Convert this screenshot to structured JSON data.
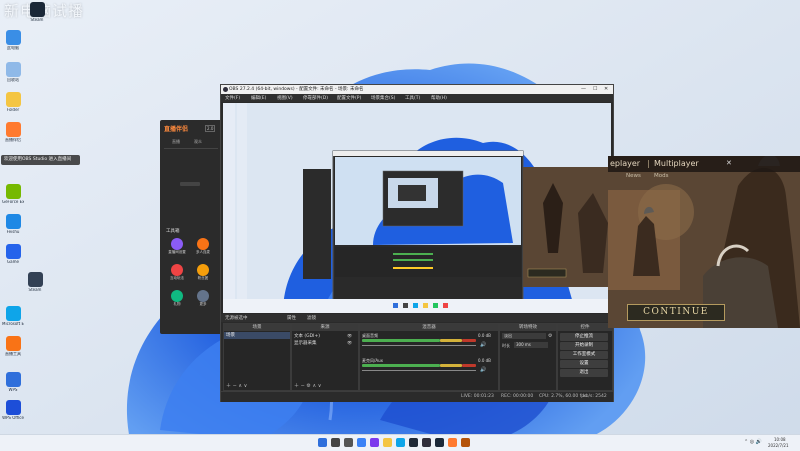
{
  "watermark": "新电脑试播",
  "desktop": {
    "icons": [
      {
        "label": "Steam",
        "icon": "steam-icon",
        "color": "#1b2838"
      },
      {
        "label": "此电脑",
        "icon": "computer-icon",
        "color": "#3a8ee6"
      },
      {
        "label": "回收站",
        "icon": "recycle-bin-icon",
        "color": "#8fb9e8"
      },
      {
        "label": "Folder",
        "icon": "folder-icon",
        "color": "#f4c542"
      },
      {
        "label": "直播伴侣",
        "icon": "live-companion-icon",
        "color": "#ff7a2f"
      },
      {
        "label": "GeForce Experience",
        "icon": "nvidia-icon",
        "color": "#76b900"
      },
      {
        "label": "Feishu",
        "icon": "feishu-icon",
        "color": "#1e88e5"
      },
      {
        "label": "Game",
        "icon": "game-icon",
        "color": "#2563eb"
      },
      {
        "label": "Steam",
        "icon": "steam-small-icon",
        "color": "#334155"
      },
      {
        "label": "Microsoft Edge",
        "icon": "edge-icon",
        "color": "#0ea5e9"
      },
      {
        "label": "直播工具",
        "icon": "live-tool-icon",
        "color": "#f97316"
      },
      {
        "label": "WPS",
        "icon": "wps-icon",
        "color": "#2f6fdb"
      },
      {
        "label": "WPS Office",
        "icon": "wps-office-icon",
        "color": "#1d4ed8"
      }
    ],
    "tooltip": "欢迎使用OBS Studio 进入直播间"
  },
  "recording_app": {
    "title": "直播伴侣",
    "version": "2.0",
    "tabs": [
      "直播",
      "观众"
    ],
    "toolbox_label": "工具箱",
    "tools": [
      "直播间设置",
      "多人连麦",
      "互动玩法",
      "粉丝团",
      "礼物",
      "更多"
    ]
  },
  "obs": {
    "title": "OBS 27.2.4 (64-bit, windows) - 配置文件: 未命名 - 场景: 未命名",
    "menu": [
      "文件(F)",
      "编辑(E)",
      "视图(V)",
      "停靠部件(D)",
      "配置文件(P)",
      "场景集合(S)",
      "工具(T)",
      "帮助(H)"
    ],
    "source_bar": {
      "label": "无源被选中",
      "props": "属性",
      "filters": "滤镜"
    },
    "docks": {
      "scenes": {
        "title": "场景",
        "items": [
          "场景"
        ]
      },
      "sources": {
        "title": "来源",
        "items": [
          "文本 (GDI+)",
          "显示器采集"
        ]
      },
      "mixer": {
        "title": "混音器",
        "channels": [
          {
            "name": "桌面音频",
            "db": "0.0 dB"
          },
          {
            "name": "麦克风/Aux",
            "db": "0.0 dB"
          }
        ]
      },
      "transitions": {
        "title": "转场特效",
        "type": "淡出",
        "duration_label": "时长",
        "duration": "300 ms"
      },
      "controls": {
        "title": "控件",
        "buttons": [
          "停止推流",
          "开始录制",
          "工作室模式",
          "设置",
          "退出"
        ]
      }
    },
    "status": {
      "live": "LIVE: 00:01:23",
      "rec": "REC: 00:00:00",
      "cpu": "CPU: 2.7%, 60.00 fps",
      "bitrate": "kb/s: 2542"
    }
  },
  "game": {
    "title_left": "eplayer",
    "title_right": "Multiplayer",
    "tabs": [
      "News",
      "Mods"
    ],
    "continue_label": "CONTINUE",
    "close": "✕"
  },
  "taskbar": {
    "time": "10:08",
    "date": "2022/7/21",
    "app_icons": [
      "windows-start-icon",
      "search-icon",
      "task-view-icon",
      "widgets-icon",
      "chat-icon",
      "file-explorer-icon",
      "edge-icon",
      "store-icon",
      "obs-icon",
      "steam-icon",
      "live-companion-icon",
      "game-icon"
    ]
  }
}
